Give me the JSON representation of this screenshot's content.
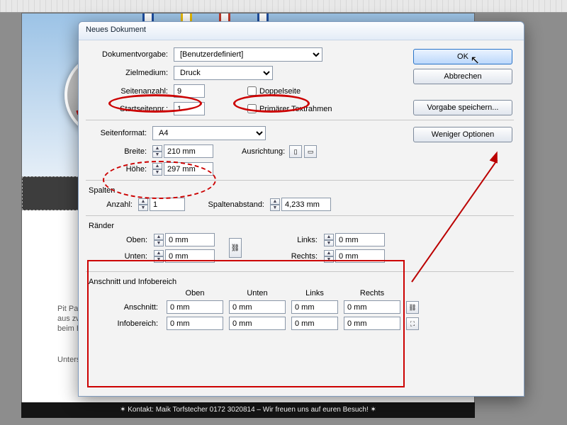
{
  "dialog": {
    "title": "Neues Dokument",
    "labels": {
      "preset": "Dokumentvorgabe:",
      "intent": "Zielmedium:",
      "pages": "Seitenanzahl:",
      "start": "Startseitennr.:",
      "facing": "Doppelseite",
      "primary": "Primärer Textrahmen",
      "pagesize": "Seitenformat:",
      "width": "Breite:",
      "height": "Höhe:",
      "orient": "Ausrichtung:",
      "columns": "Spalten",
      "col_count": "Anzahl:",
      "gutter": "Spaltenabstand:",
      "margins": "Ränder",
      "top": "Oben:",
      "bottom": "Unten:",
      "left": "Links:",
      "right": "Rechts:",
      "bleed_section": "Anschnitt und Infobereich",
      "bleed": "Anschnitt:",
      "slug": "Infobereich:"
    },
    "values": {
      "preset": "[Benutzerdefiniert]",
      "intent": "Druck",
      "pages": "9",
      "start": "1",
      "pagesize": "A4",
      "width": "210 mm",
      "height": "297 mm",
      "col_count": "1",
      "gutter": "4,233 mm",
      "margin_top": "0 mm",
      "margin_bottom": "0 mm",
      "margin_left": "0 mm",
      "margin_right": "0 mm",
      "bleed_top": "0 mm",
      "bleed_bottom": "0 mm",
      "bleed_left": "0 mm",
      "bleed_right": "0 mm",
      "slug_top": "0 mm",
      "slug_bottom": "0 mm",
      "slug_left": "0 mm",
      "slug_right": "0 mm"
    },
    "headers": {
      "top": "Oben",
      "bottom": "Unten",
      "left": "Links",
      "right": "Rechts"
    },
    "buttons": {
      "ok": "OK",
      "cancel": "Abbrechen",
      "save": "Vorgabe speichern...",
      "fewer": "Weniger Optionen"
    }
  },
  "background": {
    "side1": "Pit Pat –",
    "side2": "aus zwei F",
    "side3": "beim Billard",
    "side4": "Unterschi",
    "footer": "✶ Kontakt: Maik Torfstecher 0172 3020814 – Wir freuen uns auf euren Besuch! ✶"
  }
}
